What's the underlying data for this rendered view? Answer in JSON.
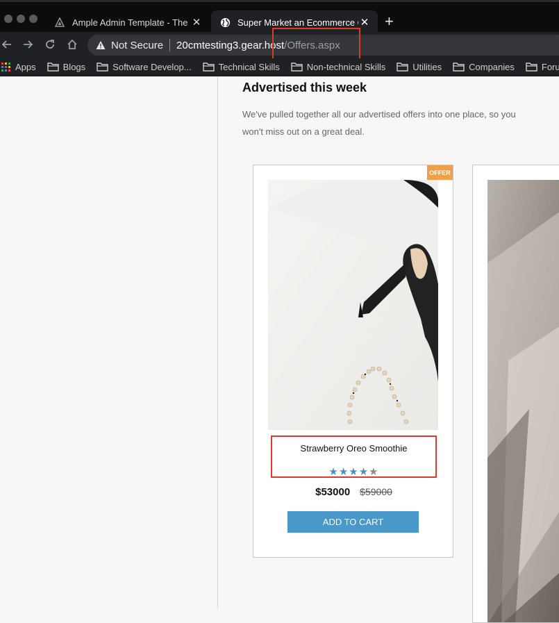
{
  "browser": {
    "tabs": [
      {
        "title": "Ample Admin Template - The U",
        "icon": "ample-logo-icon",
        "active": false
      },
      {
        "title": "Super Market an Ecommerce O",
        "icon": "globe-icon",
        "active": true
      }
    ],
    "address": {
      "security_label": "Not Secure",
      "host": "20cmtesting3.gear.host",
      "path": "/Offers.aspx"
    },
    "bookmarks": [
      {
        "label": "Apps",
        "icon": "apps-grid-icon"
      },
      {
        "label": "Blogs",
        "icon": "folder-icon"
      },
      {
        "label": "Software Develop...",
        "icon": "folder-icon"
      },
      {
        "label": "Technical Skills",
        "icon": "folder-icon"
      },
      {
        "label": "Non-technical Skills",
        "icon": "folder-icon"
      },
      {
        "label": "Utilities",
        "icon": "folder-icon"
      },
      {
        "label": "Companies",
        "icon": "folder-icon"
      },
      {
        "label": "Foru",
        "icon": "folder-icon"
      }
    ]
  },
  "section": {
    "title": "Advertised this week",
    "description": "We've pulled together all our advertised offers into one place, so you won't miss out on a great deal."
  },
  "product": {
    "badge": "OFFER",
    "name": "Strawberry Oreo Smoothie",
    "rating": 4,
    "rating_max": 5,
    "price": "$53000",
    "old_price": "$59000",
    "button_label": "ADD TO CART"
  },
  "colors": {
    "accent_blue": "#4a97c9",
    "badge_orange": "#f0a04b",
    "highlight_red": "#e0392b"
  }
}
